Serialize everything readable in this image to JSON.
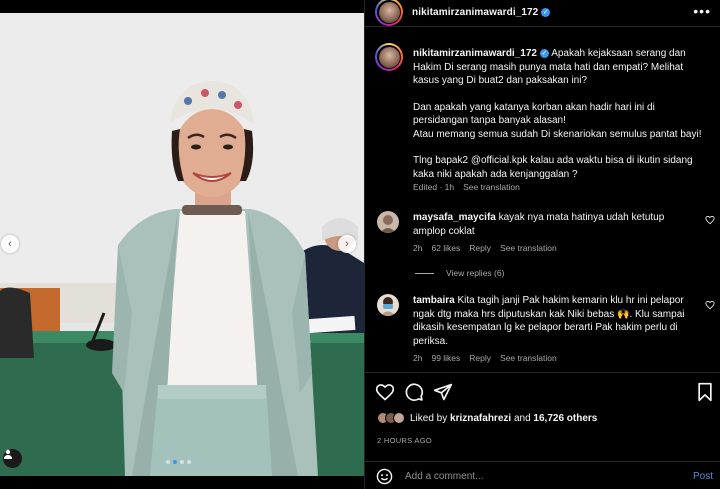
{
  "post": {
    "username": "nikitamirzanimawardi_172",
    "more_icon": "more-horizontal-icon",
    "caption_lines": [
      "Apakah kejaksaan serang dan",
      "Hakim Di serang masih punya mata hati dan empati? Melihat",
      "kasus yang Di buat2 dan paksakan ini?",
      "Dan apakah yang katanya korban akan hadir hari ini di",
      "persidangan tanpa banyak alasan!",
      "Atau memang semua sudah Di skenariokan semulus pantat bayi!",
      "Tlng bapak2 @official.kpk kalau ada waktu bisa di ikutin sidang",
      "kaka niki apakah ada kenjanggalan ?"
    ],
    "caption_meta": {
      "edited": "Edited · 1h",
      "see_translation": "See translation"
    }
  },
  "comments": [
    {
      "username": "maysafa_maycifa",
      "lines": [
        "kayak nya mata hatinya udah ketutup",
        "amplop coklat"
      ],
      "time": "2h",
      "likes": "62 likes",
      "reply": "Reply",
      "see_translation": "See translation",
      "view_replies": "View replies (6)"
    },
    {
      "username": "tambaira",
      "lines": [
        "Kita tagih janji Pak hakim kemarin klu hr ini pelapor",
        "ngak dtg maka hrs diputuskan kak Niki bebas 🙌.  Klu sampai",
        "dikasih kesempatan lg ke pelapor berarti Pak hakim perlu di",
        "periksa."
      ],
      "time": "2h",
      "likes": "99 likes",
      "reply": "Reply",
      "see_translation": "See translation"
    }
  ],
  "likes": {
    "prefix": "Liked by ",
    "user": "kriznafahrezi",
    "mid": " and ",
    "count": "16,726 others"
  },
  "timestamp": "2 HOURS AGO",
  "add_comment": {
    "placeholder": "Add a comment...",
    "post_label": "Post"
  },
  "carousel": {
    "left_arrow": "‹",
    "right_arrow": "›",
    "active_index": 1,
    "total": 4
  },
  "colors": {
    "accent": "#3897f0",
    "background": "#000000",
    "muted": "#a8a8a8"
  }
}
